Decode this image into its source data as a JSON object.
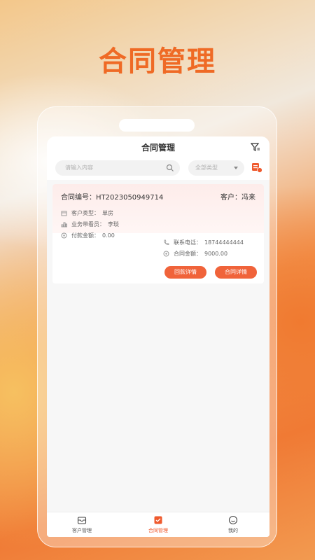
{
  "hero": {
    "title": "合同管理"
  },
  "nav": {
    "title": "合同管理"
  },
  "search": {
    "placeholder": "请输入内容",
    "type_filter": "全部类型"
  },
  "contract": {
    "number_label": "合同编号：",
    "number": "HT2023050949714",
    "customer_label": "客户：",
    "customer": "冯来",
    "customer_type_label": "客户类型：",
    "customer_type": "单房",
    "salesperson_label": "业务带看员：",
    "salesperson": "李琰",
    "paid_label": "付款金额：",
    "paid": "0.00",
    "phone_label": "联系电话：",
    "phone": "18744444444",
    "amount_label": "合同金额：",
    "amount": "9000.00",
    "btn_repay": "回款详情",
    "btn_detail": "合同详情"
  },
  "tabs": [
    {
      "label": "客户管理",
      "icon": "inbox-icon"
    },
    {
      "label": "合同管理",
      "icon": "contract-icon"
    },
    {
      "label": "我的",
      "icon": "smile-icon"
    }
  ],
  "colors": {
    "accent": "#f0633a",
    "hero": "#ef6a25"
  }
}
